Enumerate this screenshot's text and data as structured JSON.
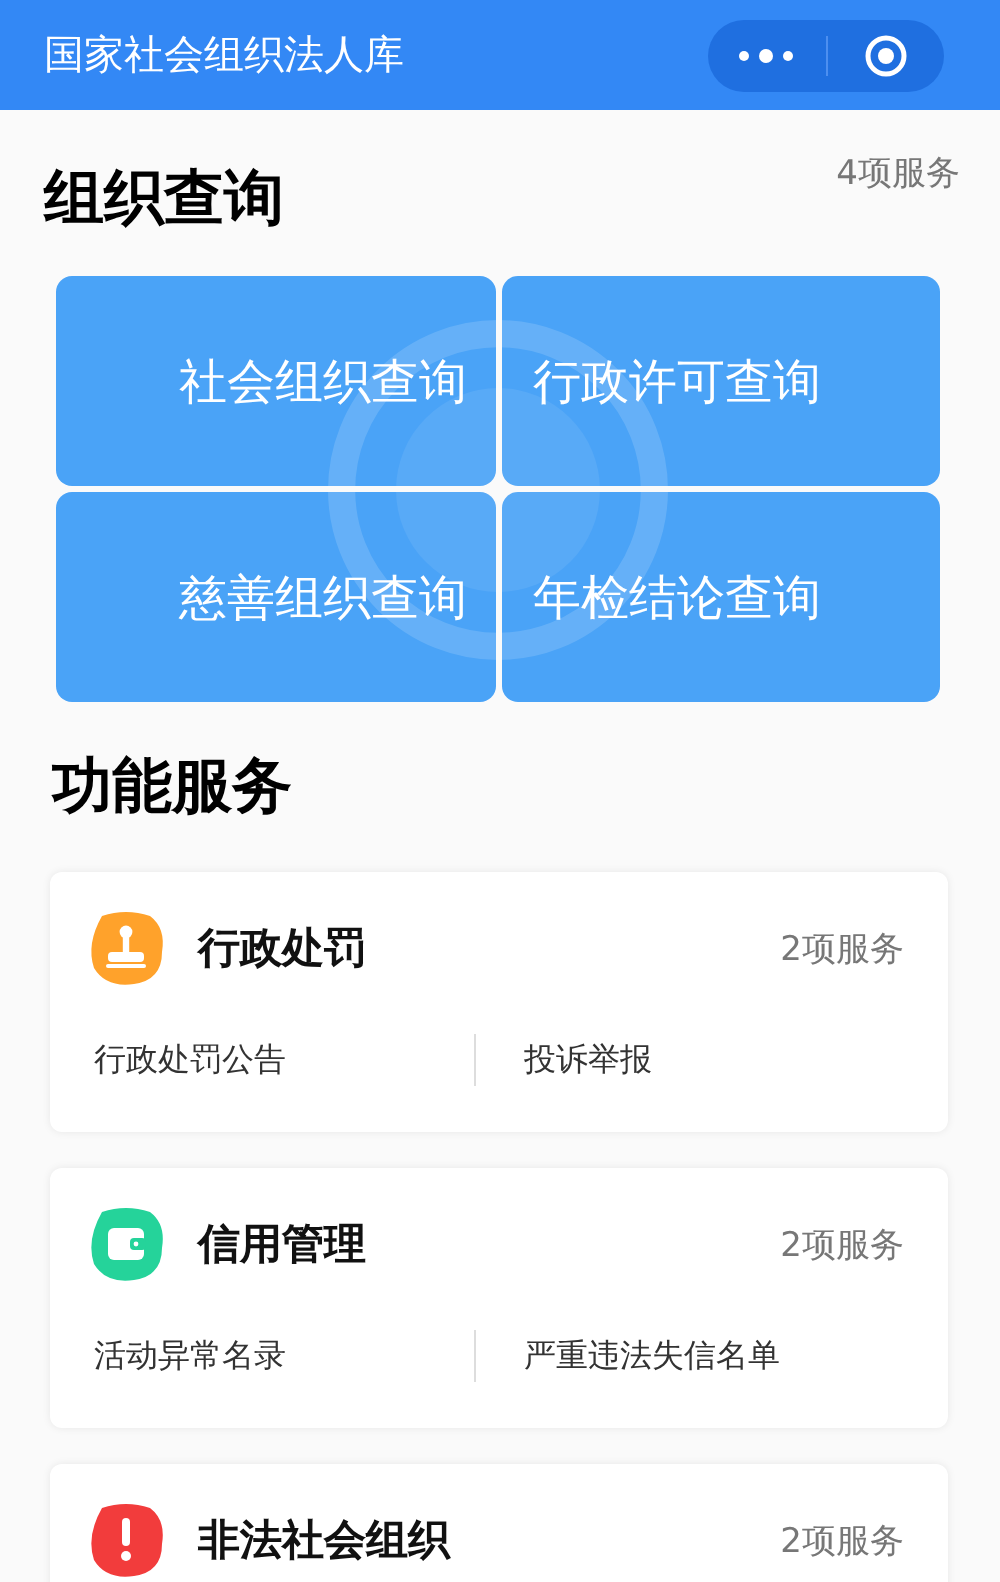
{
  "header": {
    "title": "国家社会组织法人库"
  },
  "query_section": {
    "title": "组织查询",
    "count": "4项服务",
    "tiles": [
      {
        "label": "社会组织查询"
      },
      {
        "label": "行政许可查询"
      },
      {
        "label": "慈善组织查询"
      },
      {
        "label": "年检结论查询"
      }
    ]
  },
  "service_section": {
    "title": "功能服务",
    "cards": [
      {
        "kind": "stamp",
        "color": "#ffa22b",
        "title": "行政处罚",
        "count": "2项服务",
        "links": [
          "行政处罚公告",
          "投诉举报"
        ]
      },
      {
        "kind": "wallet",
        "color": "#25d39a",
        "title": "信用管理",
        "count": "2项服务",
        "links": [
          "活动异常名录",
          "严重违法失信名单"
        ]
      },
      {
        "kind": "alert",
        "color": "#f23c3c",
        "title": "非法社会组织",
        "count": "2项服务"
      }
    ]
  }
}
